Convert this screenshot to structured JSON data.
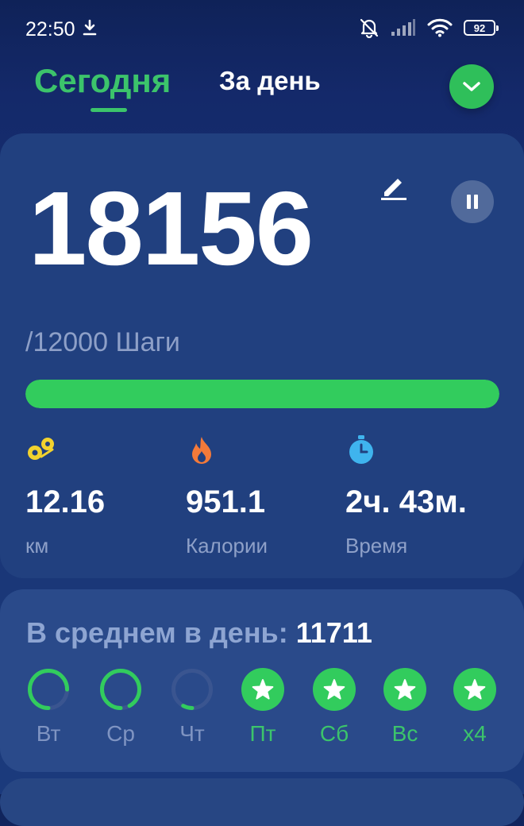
{
  "status": {
    "time": "22:50",
    "battery": "92"
  },
  "tabs": {
    "today": "Сегодня",
    "day": "За день"
  },
  "main": {
    "steps": "18156",
    "goal": "/12000 Шаги",
    "progress_percent": 100,
    "stats": [
      {
        "value": "12.16",
        "label": "км",
        "icon": "distance-icon"
      },
      {
        "value": "951.1",
        "label": "Калории",
        "icon": "flame-icon"
      },
      {
        "value": "2ч. 43м.",
        "label": "Время",
        "icon": "stopwatch-icon"
      }
    ]
  },
  "average": {
    "title": "В среднем в день:",
    "value": "11711",
    "days": [
      {
        "label": "Вт",
        "progress": 0.75,
        "done": false
      },
      {
        "label": "Ср",
        "progress": 0.92,
        "done": false
      },
      {
        "label": "Чт",
        "progress": 0.08,
        "done": false
      },
      {
        "label": "Пт",
        "progress": 1,
        "done": true
      },
      {
        "label": "Сб",
        "progress": 1,
        "done": true
      },
      {
        "label": "Вс",
        "progress": 1,
        "done": true
      },
      {
        "label": "x4",
        "progress": 1,
        "done": true
      }
    ]
  },
  "colors": {
    "accent": "#32cc5d",
    "track": "#3a5590",
    "muted": "#8ea0c8"
  }
}
